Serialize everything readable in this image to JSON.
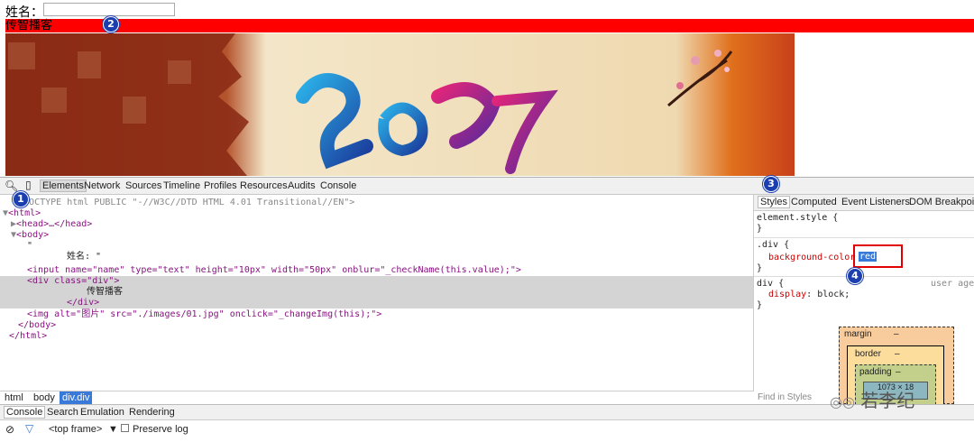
{
  "page": {
    "name_label": "姓名：",
    "red_div_text": "传智播客",
    "banner_year": "2017"
  },
  "annotations": [
    "1",
    "2",
    "3",
    "4"
  ],
  "devtools": {
    "tabs": [
      "Elements",
      "Network",
      "Sources",
      "Timeline",
      "Profiles",
      "Resources",
      "Audits",
      "Console"
    ],
    "active_tab": "Elements",
    "dom_lines": [
      "<!DOCTYPE html PUBLIC \"-//W3C//DTD HTML 4.01 Transitional//EN\">",
      "<html>",
      "<head>…</head>",
      "<body>",
      "\"",
      "姓名: \"",
      "<input name=\"name\" type=\"text\" height=\"10px\" width=\"50px\" onblur=\"_checkName(this.value);\">",
      "<div class=\"div\">",
      "传智播客",
      "</div>",
      "<img alt=\"图片\" src=\"./images/01.jpg\" onclick=\"_changeImg(this);\">",
      "</body>",
      "</html>"
    ],
    "breadcrumbs": [
      "html",
      "body",
      "div.div"
    ],
    "styles_tabs": [
      "Styles",
      "Computed",
      "Event Listeners",
      "DOM Breakpoin"
    ],
    "styles": {
      "element_style": "element.style {",
      "rule1_selector": ".div {",
      "rule1_prop": "background-color",
      "rule1_value": "red",
      "rule2_selector": "div {",
      "rule2_source": "user agent",
      "rule2_prop": "display",
      "rule2_value": "block;",
      "close": "}"
    },
    "box_model": {
      "margin_label": "margin",
      "margin_value": "–",
      "border_label": "border",
      "border_value": "–",
      "padding_label": "padding",
      "padding_value": "–",
      "content": "1073 × 18"
    },
    "find_in_styles": "Find in Styles",
    "drawer_tabs": [
      "Console",
      "Search",
      "Emulation",
      "Rendering"
    ],
    "frame_select": "<top frame>",
    "preserve_log": "Preserve log"
  },
  "watermark": "若李纪"
}
